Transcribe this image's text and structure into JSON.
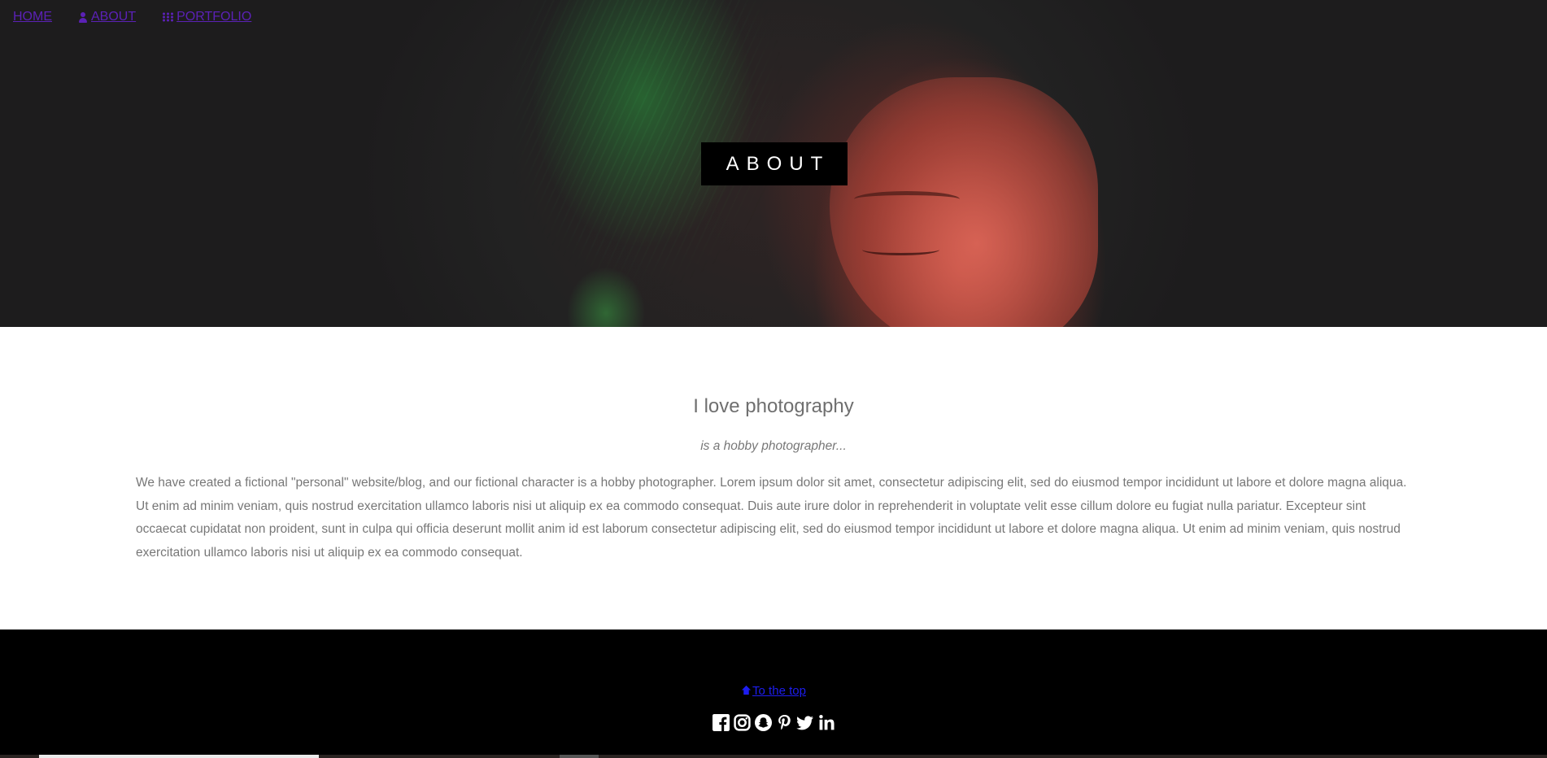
{
  "nav": {
    "items": [
      {
        "label": "HOME",
        "icon": ""
      },
      {
        "label": "ABOUT",
        "icon": "user-icon"
      },
      {
        "label": "PORTFOLIO",
        "icon": "grid-icon"
      }
    ]
  },
  "hero": {
    "title": "ABOUT"
  },
  "about": {
    "heading": "I love photography",
    "subheading": "is a hobby photographer...",
    "body": "We have created a fictional \"personal\" website/blog, and our fictional character is a hobby photographer. Lorem ipsum dolor sit amet, consectetur adipiscing elit, sed do eiusmod tempor incididunt ut labore et dolore magna aliqua. Ut enim ad minim veniam, quis nostrud exercitation ullamco laboris nisi ut aliquip ex ea commodo consequat. Duis aute irure dolor in reprehenderit in voluptate velit esse cillum dolore eu fugiat nulla pariatur. Excepteur sint occaecat cupidatat non proident, sunt in culpa qui officia deserunt mollit anim id est laborum consectetur adipiscing elit, sed do eiusmod tempor incididunt ut labore et dolore magna aliqua. Ut enim ad minim veniam, quis nostrud exercitation ullamco laboris nisi ut aliquip ex ea commodo consequat."
  },
  "footer": {
    "to_top_label": "To the top",
    "to_top_icon": "arrow-up-icon",
    "socials": [
      "facebook-icon",
      "instagram-icon",
      "snapchat-icon",
      "pinterest-icon",
      "twitter-icon",
      "linkedin-icon"
    ]
  },
  "colors": {
    "nav_link": "#5b21b6",
    "to_top_link": "#1d1df0",
    "footer_bg": "#000000",
    "body_text": "#777777"
  }
}
